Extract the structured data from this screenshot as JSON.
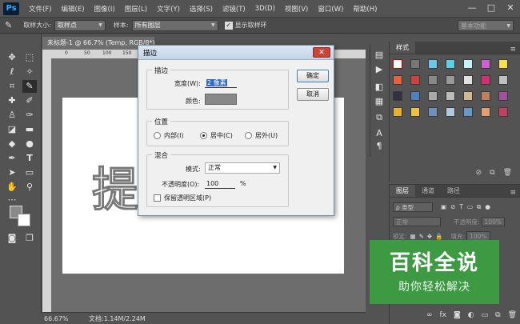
{
  "app": {
    "logo": "Ps"
  },
  "menu": [
    "文件(F)",
    "编辑(E)",
    "图像(I)",
    "图层(L)",
    "文字(Y)",
    "选择(S)",
    "滤镜(T)",
    "3D(D)",
    "视图(V)",
    "窗口(W)",
    "帮助(H)"
  ],
  "window_controls": {
    "minimize": "—",
    "restore": "□",
    "close": "✕"
  },
  "options": {
    "tool_icon": "eyedropper-icon",
    "sample_size_label": "取样大小:",
    "sample_size_value": "取样点",
    "sample_label": "样本:",
    "sample_value": "所有图层",
    "show_ring_label": "显示取样环",
    "workspace_value": "基本功能"
  },
  "document": {
    "tab_title": "未标题-1 @ 66.7% (Temp, RGB/8*)",
    "ruler_ticks": [
      "0",
      "50",
      "100",
      "150",
      "200",
      "250",
      "300",
      "350",
      "400",
      "450",
      "500",
      "550"
    ],
    "canvas_glyph": "提",
    "zoom": "66.67%",
    "doc_size": "文档:1.14M/2.24M"
  },
  "swatches_panel": {
    "tab": "样式"
  },
  "layers_panel": {
    "tabs": [
      "图层",
      "通道",
      "路径"
    ],
    "kind_label": "ρ 类型",
    "blend_mode": "正常",
    "opacity_label": "不透明度:",
    "opacity_value": "100%",
    "lock_label": "锁定:",
    "fill_label": "填充:",
    "fill_value": "100%"
  },
  "watermark": {
    "title": "百科全说",
    "subtitle": "助你轻松解决"
  },
  "dialog": {
    "title": "描边",
    "close": "✕",
    "stroke_group": "描边",
    "width_label": "宽度(W):",
    "width_value": "2 像素",
    "color_label": "颜色:",
    "color_hex": "#888888",
    "position_group": "位置",
    "position_inside": "内部(I)",
    "position_center": "居中(C)",
    "position_outside": "居外(U)",
    "blend_group": "混合",
    "mode_label": "模式:",
    "mode_value": "正常",
    "opacity_label": "不透明度(O):",
    "opacity_value": "100",
    "opacity_unit": "%",
    "preserve_label": "保留透明区域(P)",
    "ok": "确定",
    "cancel": "取消"
  }
}
